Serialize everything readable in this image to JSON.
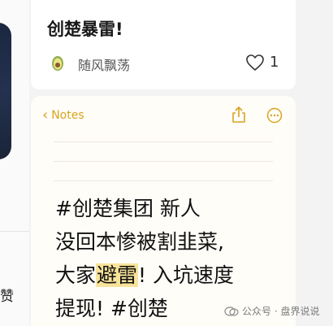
{
  "left_panel": {
    "partial_char": "赞"
  },
  "post": {
    "title": "创楚暴雷!",
    "author": "随风飘荡",
    "like_count": "1",
    "avatar_icon": "avocado-icon",
    "like_icon": "heart-outline-icon"
  },
  "notes": {
    "back_label": "Notes",
    "accent_color": "#d9a31e",
    "lines": {
      "l1": "#创楚集团 新人",
      "l2": "没回本惨被割韭菜,",
      "l3_a": "大家",
      "l3_highlight": "避雷",
      "l3_b": "!  入坑速度",
      "l4": "提现! #创楚"
    }
  },
  "watermark": {
    "text": "公众号 · 盘界说说"
  }
}
